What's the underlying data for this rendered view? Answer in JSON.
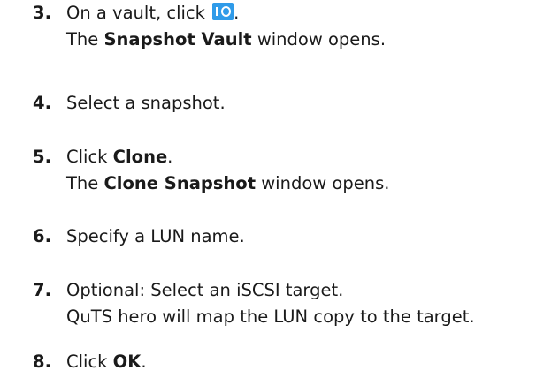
{
  "steps": [
    {
      "number": "3.",
      "text_prefix": "On a vault, click",
      "icon": "snapshot-vault-icon",
      "text_suffix": ".",
      "result_prefix": "The",
      "result_bold": "Snapshot Vault",
      "result_suffix": "window opens."
    },
    {
      "number": "4.",
      "text": "Select a snapshot."
    },
    {
      "number": "5.",
      "text_prefix": "Click",
      "text_bold": "Clone",
      "text_suffix": ".",
      "result_prefix": "The",
      "result_bold": "Clone Snapshot",
      "result_suffix": "window opens."
    },
    {
      "number": "6.",
      "text": "Specify a LUN name."
    },
    {
      "number": "7.",
      "text": "Optional: Select an iSCSI target.",
      "note": "QuTS hero will map the LUN copy to the target."
    },
    {
      "number": "8.",
      "text_prefix": "Click",
      "text_bold": "OK",
      "text_suffix": "."
    }
  ],
  "colors": {
    "icon_background": "#2f9be9",
    "text": "#1a1a1a"
  }
}
